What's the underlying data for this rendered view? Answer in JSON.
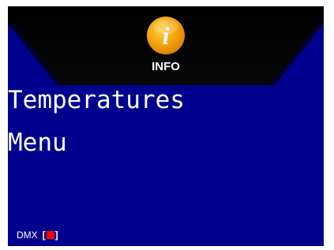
{
  "header": {
    "label": "INFO",
    "icon": "info-icon",
    "icon_glyph": "i"
  },
  "main": {
    "title_line1": "Temperatures",
    "title_line2": "Menu"
  },
  "status": {
    "dmx_label": "DMX",
    "bracket_open": "[",
    "bracket_close": "]",
    "dmx_indicator_color": "#ff0000"
  },
  "colors": {
    "background": "#00008e",
    "header_band": "#000000",
    "icon_orange": "#f5a30a",
    "text": "#ffffff"
  }
}
